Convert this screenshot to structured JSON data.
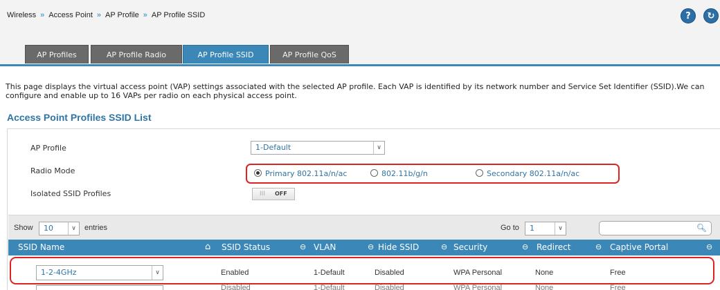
{
  "breadcrumb": [
    "Wireless",
    "Access Point",
    "AP Profile",
    "AP Profile SSID"
  ],
  "breadcrumb_separator": "»",
  "help_icons": [
    "?",
    "↻"
  ],
  "tabs": [
    {
      "label": "AP Profiles",
      "active": false
    },
    {
      "label": "AP Profile Radio",
      "active": false
    },
    {
      "label": "AP Profile SSID",
      "active": true
    },
    {
      "label": "AP Profile QoS",
      "active": false
    }
  ],
  "description": "This page displays the virtual access point (VAP) settings associated with the selected AP profile. Each VAP is identified by its network number and Service Set Identifier (SSID).We can configure and enable up to 16 VAPs per radio on each physical access point.",
  "section_title": "Access Point Profiles SSID List",
  "form": {
    "ap_profile_label": "AP Profile",
    "ap_profile_value": "1-Default",
    "radio_mode_label": "Radio Mode",
    "radio_options": [
      {
        "label": "Primary 802.11a/n/ac",
        "selected": true
      },
      {
        "label": "802.11b/g/n",
        "selected": false
      },
      {
        "label": "Secondary 802.11a/n/ac",
        "selected": false
      }
    ],
    "isolated_label": "Isolated SSID Profiles",
    "isolated_toggle_knob": "III",
    "isolated_toggle_state": "OFF"
  },
  "table_controls": {
    "show_label": "Show",
    "entries_value": "10",
    "entries_label": "entries",
    "goto_label": "Go to",
    "goto_value": "1",
    "search_value": ""
  },
  "table": {
    "columns": [
      "SSID Name",
      "SSID Status",
      "VLAN",
      "Hide SSID",
      "Security",
      "Redirect",
      "Captive Portal"
    ],
    "sort_glyph": "⊖",
    "home_glyph": "⌂",
    "row": {
      "ssid_select": "1-2-4GHz",
      "status": "Enabled",
      "vlan": "1-Default",
      "hide": "Disabled",
      "security": "WPA Personal",
      "redirect": "None",
      "portal": "Free"
    },
    "next_row_partial": {
      "status": "Disabled",
      "vlan": "1-Default",
      "hide": "Disabled",
      "security": "WPA Personal",
      "redirect": "None",
      "portal": "Free"
    }
  },
  "colors": {
    "accent": "#3a87b8",
    "tab_inactive": "#6a6a6a",
    "highlight": "#dd2222"
  }
}
